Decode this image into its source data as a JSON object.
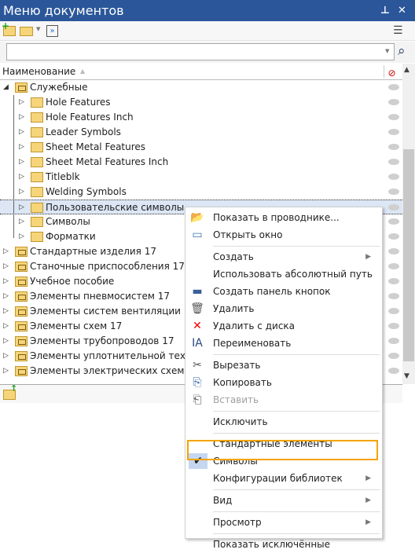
{
  "window": {
    "title": "Меню документов"
  },
  "toolbar": {
    "icons": [
      "add-library-icon",
      "open-folder-icon",
      "collapse-icon",
      "view-options-icon"
    ]
  },
  "search": {
    "value": "",
    "placeholder": ""
  },
  "header": {
    "column": "Наименование"
  },
  "tree": [
    {
      "label": "Служебные",
      "level": 0,
      "expanded": true
    },
    {
      "label": "Hole Features",
      "level": 1
    },
    {
      "label": "Hole Features Inch",
      "level": 1
    },
    {
      "label": "Leader Symbols",
      "level": 1
    },
    {
      "label": "Sheet Metal Features",
      "level": 1
    },
    {
      "label": "Sheet Metal Features Inch",
      "level": 1
    },
    {
      "label": "Titleblk",
      "level": 1
    },
    {
      "label": "Welding Symbols",
      "level": 1
    },
    {
      "label": "Пользовательские символы",
      "level": 1,
      "selected": true
    },
    {
      "label": "Символы",
      "level": 1
    },
    {
      "label": "Форматки",
      "level": 1
    },
    {
      "label": "Стандартные изделия 17",
      "level": 0
    },
    {
      "label": "Станочные приспособления 17",
      "level": 0
    },
    {
      "label": "Учебное пособие",
      "level": 0
    },
    {
      "label": "Элементы пневмосистем 17",
      "level": 0
    },
    {
      "label": "Элементы систем вентиляции 17",
      "level": 0
    },
    {
      "label": "Элементы схем 17",
      "level": 0
    },
    {
      "label": "Элементы трубопроводов 17",
      "level": 0
    },
    {
      "label": "Элементы уплотнительной техники",
      "level": 0
    },
    {
      "label": "Элементы электрических схем",
      "level": 0
    }
  ],
  "context_menu": {
    "items": [
      {
        "label": "Показать в проводнике...",
        "icon": "folder-up-icon",
        "top": 0
      },
      {
        "label": "Открыть окно",
        "icon": "new-window-icon"
      },
      {
        "sep": true
      },
      {
        "label": "Создать",
        "submenu": true
      },
      {
        "label": "Использовать абсолютный путь"
      },
      {
        "label": "Создать панель кнопок",
        "icon": "toolbar-icon"
      },
      {
        "label": "Удалить",
        "icon": "trash-icon"
      },
      {
        "label": "Удалить с диска",
        "icon": "red-x-icon"
      },
      {
        "label": "Переименовать",
        "icon": "rename-icon"
      },
      {
        "sep": true
      },
      {
        "label": "Вырезать",
        "icon": "scissors-icon"
      },
      {
        "label": "Копировать",
        "icon": "copy-icon"
      },
      {
        "label": "Вставить",
        "icon": "paste-icon",
        "disabled": true
      },
      {
        "sep": true
      },
      {
        "label": "Исключить"
      },
      {
        "sep": true
      },
      {
        "label": "Стандартные элементы"
      },
      {
        "label": "Символы",
        "checked": true,
        "highlighted": true
      },
      {
        "label": "Конфигурации библиотек",
        "submenu": true
      },
      {
        "sep": true
      },
      {
        "label": "Вид",
        "submenu": true
      },
      {
        "sep": true
      },
      {
        "label": "Просмотр",
        "submenu": true
      },
      {
        "sep": true
      },
      {
        "label": "Показать исключённые"
      }
    ]
  },
  "colors": {
    "titlebar": "#2b579a",
    "selection": "#dce6f4",
    "highlight_border": "#f5a300"
  }
}
